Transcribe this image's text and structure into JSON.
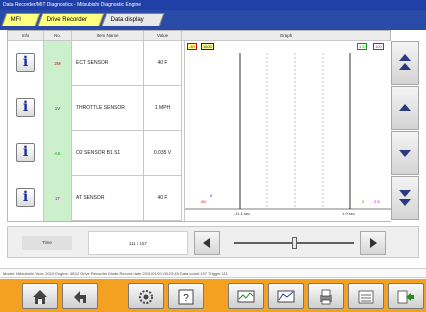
{
  "window": {
    "title": "Data Recorder/MIT Diagnostics - Mitsubishi Diagnostic Engine"
  },
  "tabs": [
    {
      "label": "MFI",
      "state": "active"
    },
    {
      "label": "Drive Recorder",
      "state": "active"
    },
    {
      "label": "Data display",
      "state": "inactive"
    }
  ],
  "table": {
    "headers": {
      "info": "Info",
      "no": "No.",
      "item_name": "Item Name",
      "value": "Value",
      "graph": "Graph"
    },
    "rows": [
      {
        "no": "2M",
        "name": "ECT SENSOR",
        "value": "40 F"
      },
      {
        "no": "1V",
        "name": "THROTTLE SENSOR",
        "value": "1 MPH"
      },
      {
        "no": "AS",
        "name": "O2 SENSOR B1 S1",
        "value": "0.035 V"
      },
      {
        "no": "1T",
        "name": "AT SENSOR",
        "value": "40 F"
      }
    ]
  },
  "graph": {
    "top_left_tags": [
      "-40",
      "1600"
    ],
    "top_right_tags": [
      "1.5",
      "100"
    ],
    "bottom_left_tags": [
      "-40",
      "0"
    ],
    "bottom_right_tags": [
      "0",
      "2.5"
    ],
    "x_axis": {
      "left": "-11.1 sec",
      "right": "1.9 sec"
    },
    "colors": {
      "red": "#d00000",
      "blue": "#0020c0",
      "green": "#00a000",
      "magenta": "#c000c0"
    }
  },
  "navigation": {
    "time_label": "Time",
    "time_value": "111 / 157",
    "slider_position": 0.52
  },
  "status_bar": {
    "text": "Model: Mitsubishi  Year: 2010  Engine: 4B12  Drive Recorder Mode  Record date 2011/01/01 08:23:45  Data count 157  Trigger 111"
  },
  "toolbar": {
    "icons": [
      "home-icon",
      "back-icon",
      "settings-icon",
      "help-icon",
      "save-data-icon",
      "chart-settings-icon",
      "print-icon",
      "list-icon",
      "exit-icon"
    ],
    "help_label": "?"
  }
}
